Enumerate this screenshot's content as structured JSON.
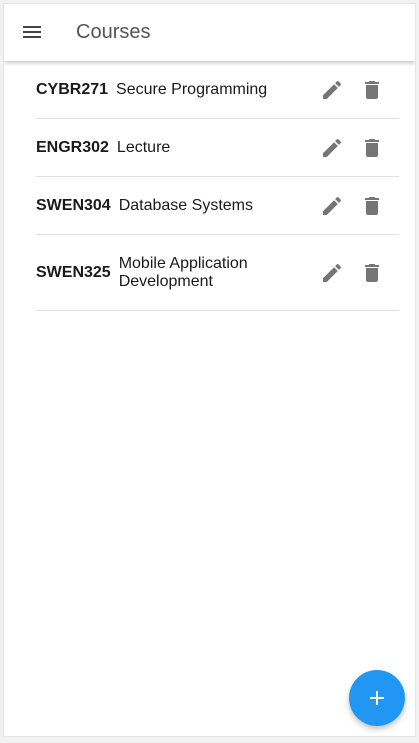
{
  "appbar": {
    "title": "Courses",
    "menu_icon": "hamburger-menu-icon"
  },
  "courses": [
    {
      "code": "CYBR271",
      "name": "Secure Programming"
    },
    {
      "code": "ENGR302",
      "name": "Lecture"
    },
    {
      "code": "SWEN304",
      "name": "Database Systems"
    },
    {
      "code": "SWEN325",
      "name": "Mobile Application Development"
    }
  ],
  "row_actions": {
    "edit_icon": "pencil-icon",
    "delete_icon": "trash-icon"
  },
  "fab": {
    "icon": "plus-icon",
    "color": "#2196f3"
  },
  "colors": {
    "icon": "#757575",
    "divider": "#e0e0e0",
    "title": "#555555"
  }
}
